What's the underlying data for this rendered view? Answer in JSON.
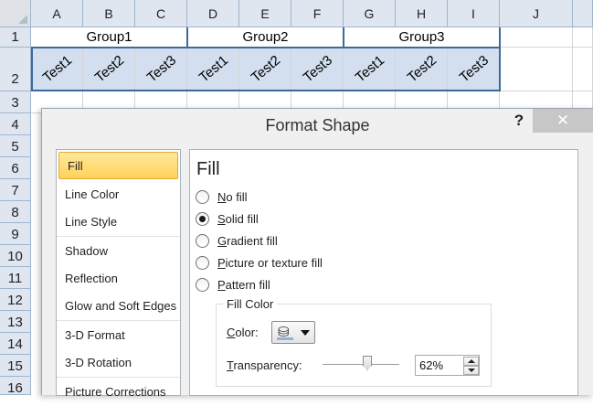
{
  "sheet": {
    "columns": [
      "A",
      "B",
      "C",
      "D",
      "E",
      "F",
      "G",
      "H",
      "I",
      "J"
    ],
    "rows": [
      "1",
      "2",
      "3",
      "4",
      "5",
      "6",
      "7",
      "8",
      "9",
      "10",
      "11",
      "12",
      "13",
      "14",
      "15",
      "16"
    ],
    "groups": [
      "Group1",
      "Group2",
      "Group3"
    ],
    "tests": [
      "Test1",
      "Test2",
      "Test3",
      "Test1",
      "Test2",
      "Test3",
      "Test1",
      "Test2",
      "Test3"
    ]
  },
  "dialog": {
    "title": "Format Shape",
    "help_label": "?",
    "close_label": "✕",
    "categories": [
      "Fill",
      "Line Color",
      "Line Style",
      "Shadow",
      "Reflection",
      "Glow and Soft Edges",
      "3-D Format",
      "3-D Rotation",
      "Picture Corrections"
    ],
    "selected_category": "Fill",
    "pane_title": "Fill",
    "fill_options": [
      {
        "accel": "N",
        "rest": "o fill",
        "checked": false
      },
      {
        "accel": "S",
        "rest": "olid fill",
        "checked": true
      },
      {
        "accel": "G",
        "rest": "radient fill",
        "checked": false
      },
      {
        "accel": "P",
        "rest": "icture or texture fill",
        "checked": false
      },
      {
        "accel": "P",
        "rest": "attern fill",
        "checked": false
      }
    ],
    "fill_color_group": "Fill Color",
    "color_label": {
      "accel": "C",
      "rest": "olor:"
    },
    "transparency_label": {
      "accel": "T",
      "rest": "ransparency:"
    },
    "transparency_value": "62%",
    "bucket_icon": "paint-bucket-icon",
    "swatch_color": "#8fb4dc"
  }
}
